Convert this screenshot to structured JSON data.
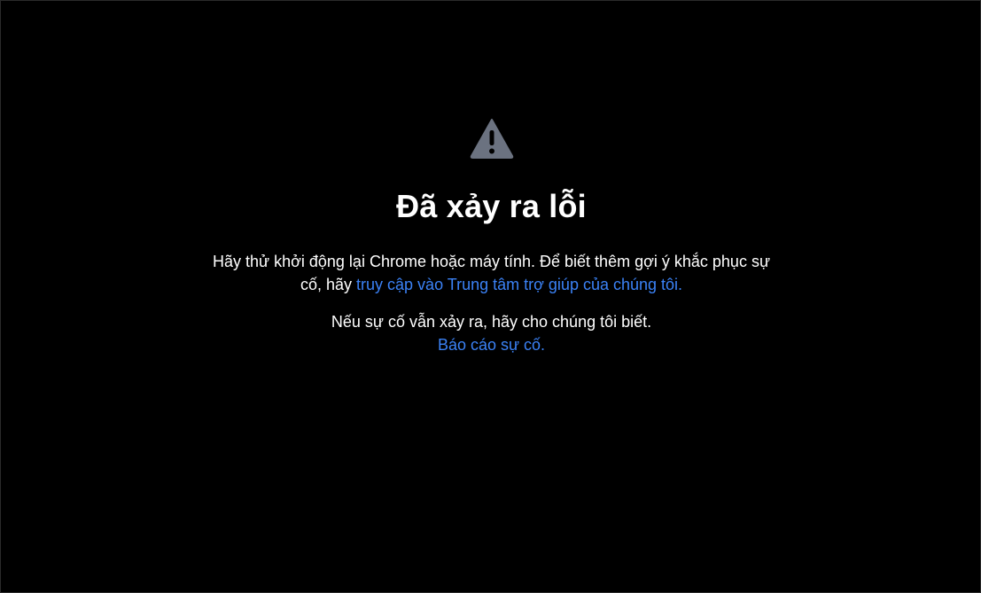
{
  "error": {
    "icon": "warning-icon",
    "icon_color": "#6b7280",
    "title": "Đã xảy ra lỗi",
    "message_prefix": "Hãy thử khởi động lại Chrome hoặc máy tính. Để biết thêm gợi ý khắc phục sự cố, hãy",
    "help_link": "truy cập vào Trung tâm trợ giúp của chúng tôi.",
    "persist_text": "Nếu sự cố vẫn xảy ra, hãy cho chúng tôi biết.",
    "report_link": "Báo cáo sự cố.",
    "link_color": "#3b82f6"
  }
}
